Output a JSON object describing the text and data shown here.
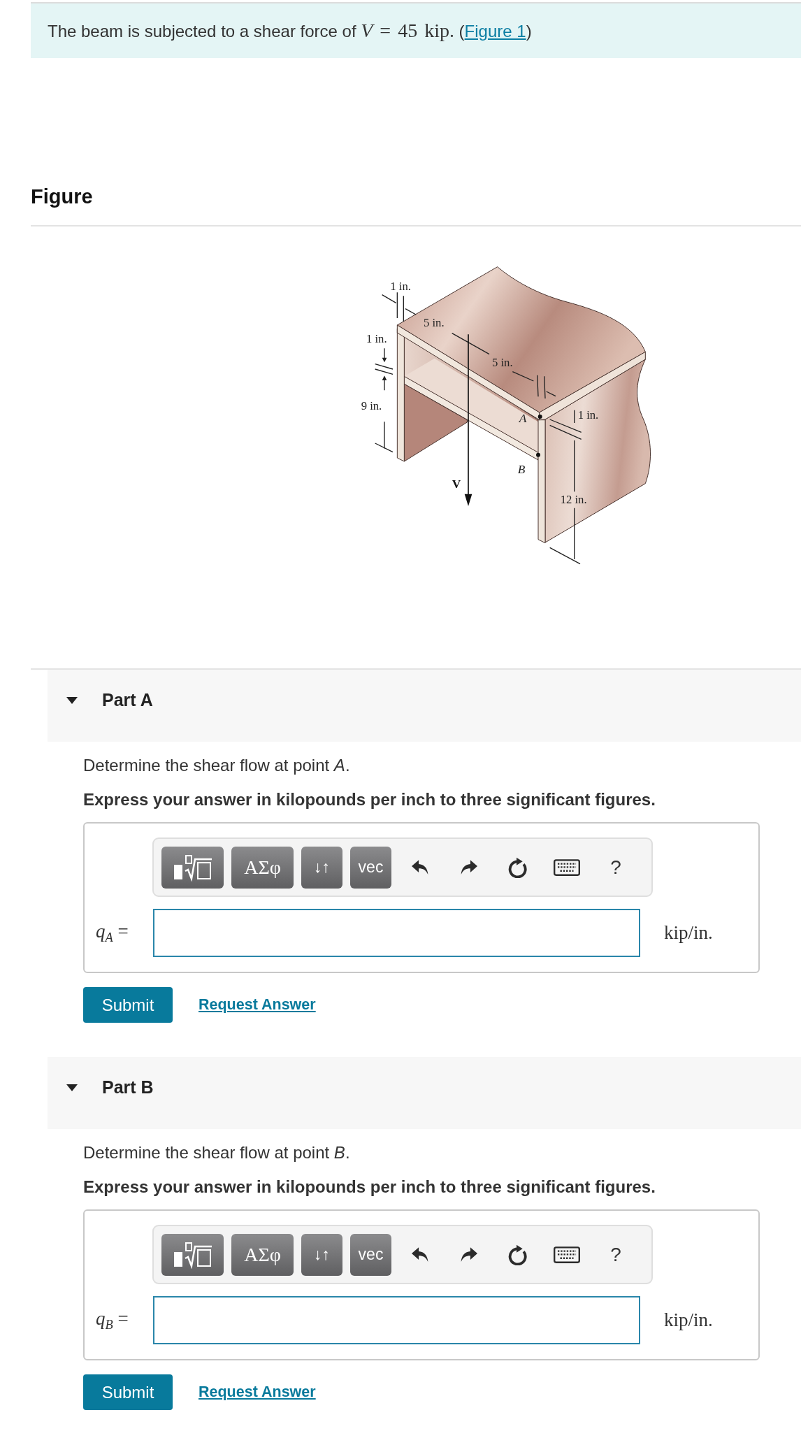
{
  "problem": {
    "text": "The beam is subjected to a shear force of",
    "formula": "*V* = 45 kip.",
    "link_open": "(",
    "link": "Figure 1",
    "link_close": ")"
  },
  "figure": {
    "heading": "Figure",
    "dimension_labels": [
      "1 in.",
      "5 in.",
      "1 in.",
      "5 in.",
      "9 in.",
      "1 in.",
      "12 in."
    ],
    "point_labels": [
      "A",
      "B"
    ],
    "force_label": "V"
  },
  "parts": [
    {
      "title": "Part A",
      "expanded": true,
      "question": "Determine the shear flow at point *A*.",
      "instruction": "Express your answer in kilopounds per inch to three significant figures.",
      "toolbar": [
        {
          "kind": "templates"
        },
        {
          "kind": "greek",
          "label": "ΑΣφ"
        },
        {
          "kind": "symbol",
          "label": "↓↑"
        },
        {
          "kind": "symbol",
          "label": "vec"
        },
        {
          "kind": "undo"
        },
        {
          "kind": "redo"
        },
        {
          "kind": "reset"
        },
        {
          "kind": "keyboard"
        },
        {
          "kind": "help",
          "label": "?"
        }
      ],
      "answer_label": "*q*$_{A}$ =",
      "unit": "kip/in.",
      "submit": "Submit",
      "request_answer": "Request Answer"
    },
    {
      "title": "Part B",
      "expanded": true,
      "question": "Determine the shear flow at point *B*.",
      "instruction": "Express your answer in kilopounds per inch to three significant figures.",
      "toolbar": [
        {
          "kind": "templates"
        },
        {
          "kind": "greek",
          "label": "ΑΣφ"
        },
        {
          "kind": "symbol",
          "label": "↓↑"
        },
        {
          "kind": "symbol",
          "label": "vec"
        },
        {
          "kind": "undo"
        },
        {
          "kind": "redo"
        },
        {
          "kind": "reset"
        },
        {
          "kind": "keyboard"
        },
        {
          "kind": "help",
          "label": "?"
        }
      ],
      "answer_label": "*q*$_{B}$ =",
      "unit": "kip/in.",
      "submit": "Submit",
      "request_answer": "Request Answer"
    }
  ]
}
